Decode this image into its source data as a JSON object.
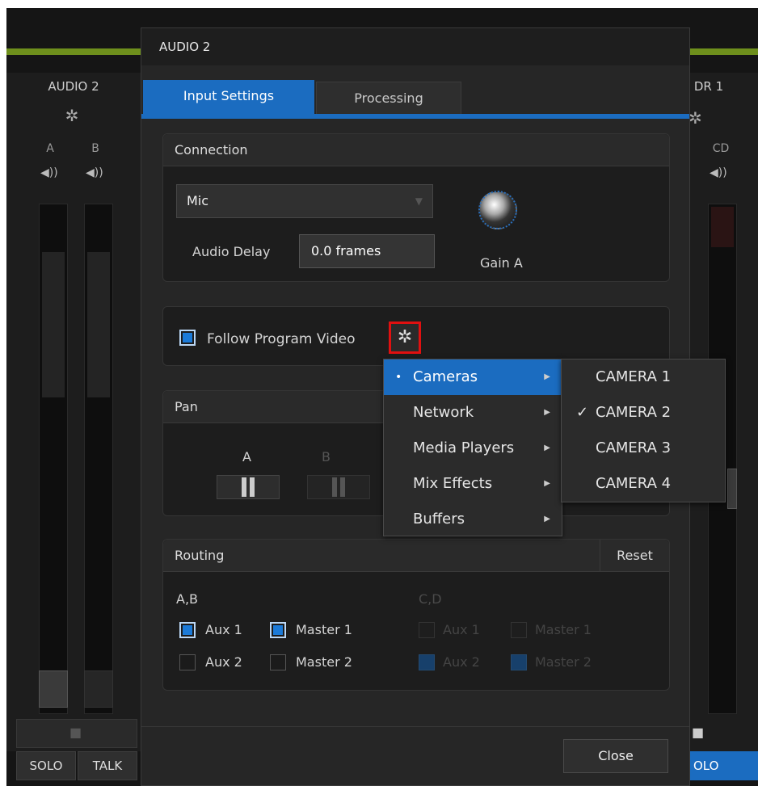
{
  "left_strip": {
    "title": "AUDIO 2",
    "ch_a": "A",
    "ch_b": "B",
    "solo": "SOLO",
    "talk": "TALK"
  },
  "right_strip": {
    "title": "DR 1",
    "ch": "CD",
    "solo": "OLO"
  },
  "dialog": {
    "title": "AUDIO 2",
    "tabs": [
      {
        "label": "Input Settings",
        "active": true
      },
      {
        "label": "Processing",
        "active": false
      }
    ],
    "connection": {
      "header": "Connection",
      "source": "Mic",
      "delay_label": "Audio Delay",
      "delay_value": "0.0 frames",
      "gain_label": "Gain A"
    },
    "follow": {
      "label": "Follow Program Video",
      "checked": true
    },
    "pan": {
      "header": "Pan",
      "a": "A",
      "b": "B"
    },
    "routing": {
      "header": "Routing",
      "reset": "Reset",
      "group1_label": "A,B",
      "group2_label": "C,D",
      "aux1": "Aux 1",
      "aux2": "Aux 2",
      "master1": "Master 1",
      "master2": "Master 2"
    },
    "close": "Close"
  },
  "menu": {
    "items": [
      {
        "label": "Cameras",
        "selected": true
      },
      {
        "label": "Network",
        "selected": false
      },
      {
        "label": "Media Players",
        "selected": false
      },
      {
        "label": "Mix Effects",
        "selected": false
      },
      {
        "label": "Buffers",
        "selected": false
      }
    ],
    "submenu": [
      {
        "label": "CAMERA 1",
        "checked": false
      },
      {
        "label": "CAMERA 2",
        "checked": true
      },
      {
        "label": "CAMERA 3",
        "checked": false
      },
      {
        "label": "CAMERA 4",
        "checked": false
      }
    ],
    "check_mark": "✓",
    "bullet": "•",
    "arrow": "▶"
  },
  "colors": {
    "accent": "#1b6cc0",
    "highlight_red": "#e01010",
    "green_bar": "#6e8f1c"
  }
}
